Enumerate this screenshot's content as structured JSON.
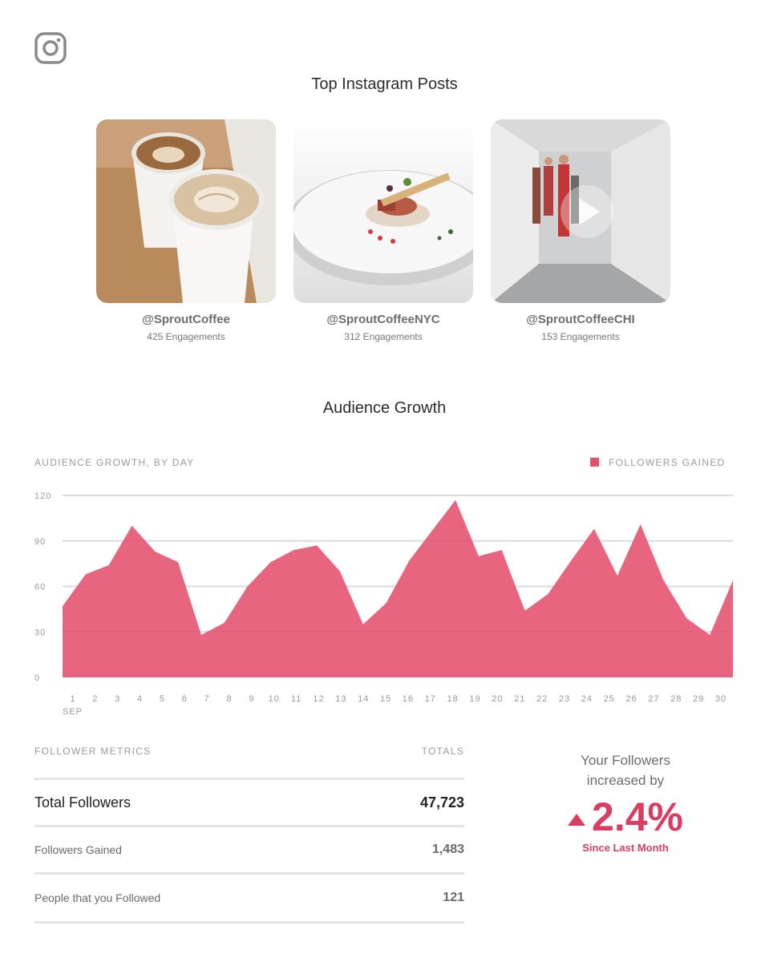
{
  "header": {
    "logo_icon": "instagram-icon"
  },
  "top_posts": {
    "title": "Top Instagram Posts",
    "posts": [
      {
        "handle": "@SproutCoffee",
        "engagements": "425 Engagements",
        "image": "latte-cups-photo"
      },
      {
        "handle": "@SproutCoffeeNYC",
        "engagements": "312 Engagements",
        "image": "plated-dish-photo"
      },
      {
        "handle": "@SproutCoffeeCHI",
        "engagements": "153 Engagements",
        "image": "office-hallway-video"
      }
    ]
  },
  "audience": {
    "title": "Audience Growth",
    "chart_label": "AUDIENCE GROWTH, BY DAY",
    "legend_label": "FOLLOWERS GAINED",
    "month_label": "SEP"
  },
  "chart_data": {
    "type": "area",
    "title": "AUDIENCE GROWTH, BY DAY",
    "x": [
      1,
      2,
      3,
      4,
      5,
      6,
      7,
      8,
      9,
      10,
      11,
      12,
      13,
      14,
      15,
      16,
      17,
      18,
      19,
      20,
      21,
      22,
      23,
      24,
      25,
      26,
      27,
      28,
      29,
      30
    ],
    "series": [
      {
        "name": "FOLLOWERS GAINED",
        "values": [
          47,
          68,
          74,
          100,
          83,
          76,
          28,
          36,
          60,
          76,
          84,
          87,
          70,
          35,
          49,
          77,
          97,
          117,
          80,
          84,
          44,
          55,
          77,
          98,
          67,
          101,
          64,
          39,
          28,
          64
        ]
      }
    ],
    "ylim": [
      0,
      120
    ],
    "yticks": [
      0,
      30,
      60,
      90,
      120
    ],
    "xlabel": "SEP",
    "ylabel": "",
    "grid": true,
    "legend": "top-right",
    "color": "#e5506d"
  },
  "metrics": {
    "header_left": "FOLLOWER METRICS",
    "header_right": "TOTALS",
    "rows": [
      {
        "label": "Total Followers",
        "value": "47,723"
      },
      {
        "label": "Followers Gained",
        "value": "1,483"
      },
      {
        "label": "People that you Followed",
        "value": "121"
      }
    ]
  },
  "growth": {
    "line1": "Your Followers",
    "line2": "increased by",
    "percent": "2.4%",
    "since": "Since Last Month",
    "accent": "#d93d5f"
  }
}
